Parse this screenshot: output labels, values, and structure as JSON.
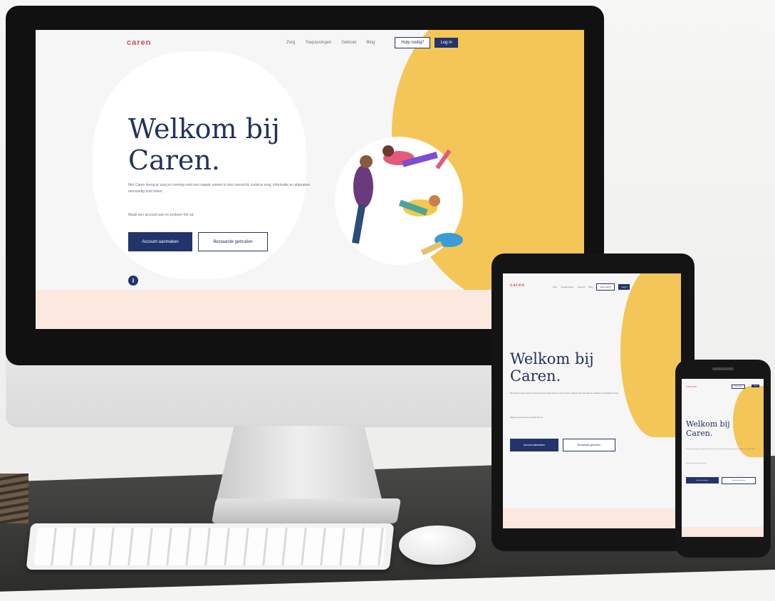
{
  "site": {
    "logo": "caren",
    "nav": [
      "Zorg",
      "Toepassingen",
      "Gebruik",
      "Blog"
    ],
    "register_button": "Hulp nodig?",
    "login_button": "Log in"
  },
  "hero": {
    "title_line1": "Welkom bij",
    "title_line2": "Caren.",
    "paragraph1": "Met Caren breng je zorg en overleg rond een naaste samen in één overzicht, zodat je zorg, informatie en afspraken eenvoudig kunt delen.",
    "paragraph2": "Maak een account aan en probeer het uit.",
    "primary_cta": "Account aanmaken",
    "secondary_cta": "Bestaande gebruiker"
  },
  "colors": {
    "accent_yellow": "#f4c658",
    "brand_navy": "#22346b",
    "logo_red": "#d84f5f",
    "peach": "#fbe9df"
  },
  "icons": {
    "info": "info-icon"
  }
}
